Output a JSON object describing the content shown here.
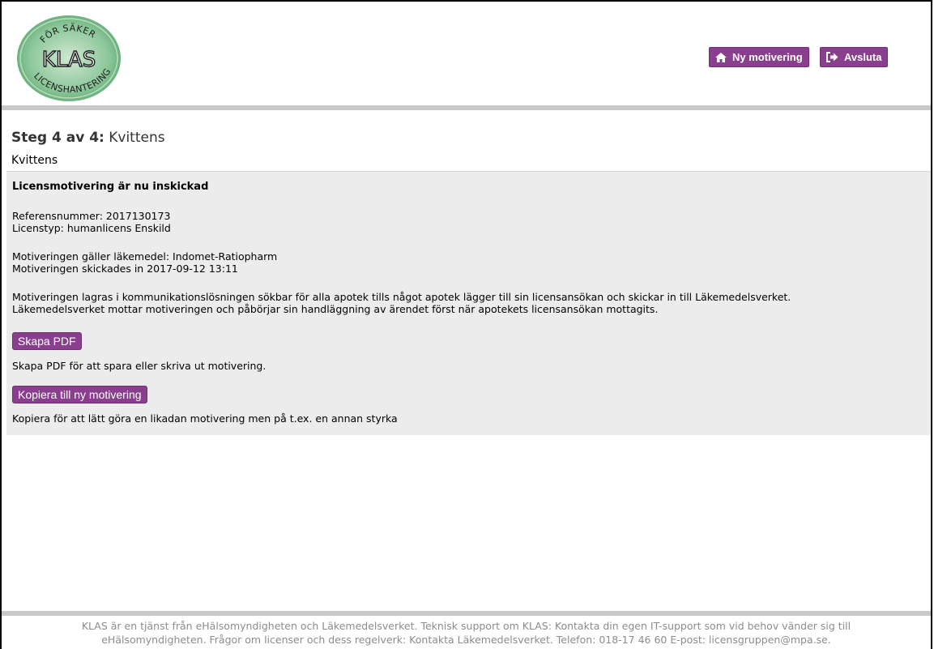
{
  "header": {
    "logo": {
      "line1": "FÖR SÄKER",
      "line2": "KLAS",
      "line3": "LICENSHANTERING"
    },
    "buttons": {
      "ny_motivering": "Ny motivering",
      "avsluta": "Avsluta"
    }
  },
  "step": {
    "label": "Steg 4 av 4:",
    "name": "Kvittens",
    "subtitle": "Kvittens"
  },
  "receipt": {
    "heading": "Licensmotivering är nu inskickad",
    "referensnummer": "Referensnummer: 2017130173",
    "licenstyp": "Licenstyp: humanlicens Enskild",
    "lakemedel": "Motiveringen gäller läkemedel: Indomet-Ratiopharm",
    "skickades": "Motiveringen skickades in 2017-09-12 13:11",
    "info_line1": "Motiveringen lagras i kommunikationslösningen sökbar för alla apotek tills något apotek lägger till sin licensansökan och skickar in till Läkemedelsverket.",
    "info_line2": "Läkemedelsverket mottar motiveringen och påbörjar sin handläggning av ärendet först när apotekets licensansökan mottagits.",
    "pdf_button": "Skapa PDF",
    "pdf_help": "Skapa PDF för att spara eller skriva ut motivering.",
    "copy_button": "Kopiera till ny motivering",
    "copy_help": "Kopiera för att lätt göra en likadan motivering men på t.ex. en annan styrka"
  },
  "footer": {
    "line1": "KLAS är en tjänst från eHälsomyndigheten och Läkemedelsverket. Teknisk support om KLAS: Kontakta din egen IT-support som vid behov vänder sig till",
    "line2": "eHälsomyndigheten. Frågor om licenser och dess regelverk: Kontakta Läkemedelsverket. Telefon: 018-17 46 60 E-post: licensgruppen@mpa.se."
  },
  "colors": {
    "accent": "#8a3f8e",
    "logo_green": "#6fb47f",
    "panel_bg": "#ececec",
    "separator": "#c8c8c8"
  },
  "icons": {
    "ny_motivering": "home-icon",
    "avsluta": "sign-out-icon"
  }
}
